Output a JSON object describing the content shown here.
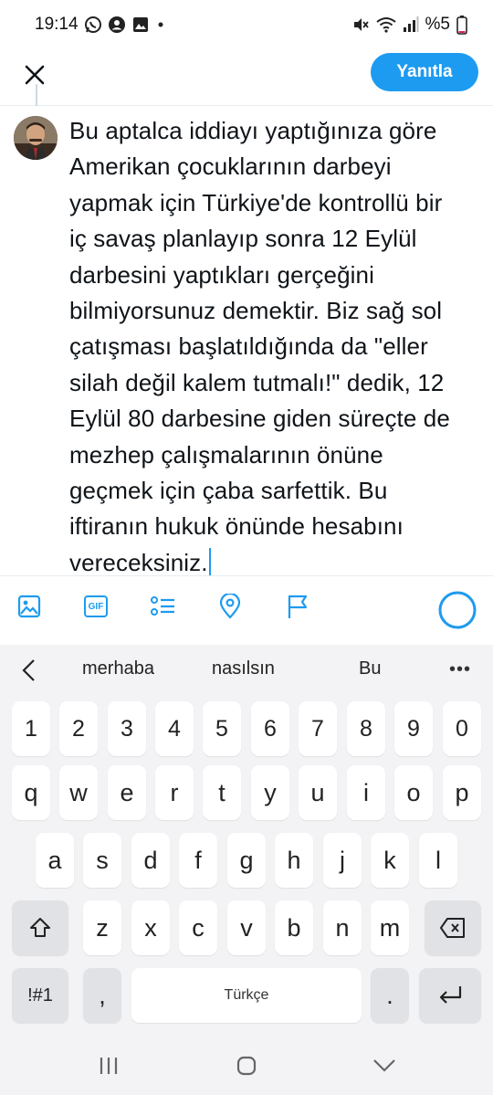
{
  "status": {
    "time": "19:14",
    "battery": "%5"
  },
  "header": {
    "reply_label": "Yanıtla"
  },
  "compose": {
    "lines": [
      "Bu aptalca iddiayı yaptığınıza göre",
      "Amerikan çocuklarının darbeyi",
      "yapmak için Türkiye'de kontrollü bir",
      "iç savaş planlayıp sonra 12 Eylül",
      "darbesini yaptıkları gerçeğini",
      "bilmiyorsunuz demektir. Biz sağ sol",
      "çatışması başlatıldığında da \"eller",
      "silah değil kalem tutmalı!\" dedik, 12",
      "Eylül 80 darbesine giden süreçte de",
      "mezhep çalışmalarının önüne",
      "geçmek için çaba sarfettik. Bu",
      "iftiranın hukuk önünde hesabını",
      "vereceksiniz."
    ]
  },
  "toolbar": {
    "gif_label": "GIF"
  },
  "keyboard": {
    "suggestions": [
      "merhaba",
      "nasılsın",
      "Bu"
    ],
    "more": "•••",
    "row_numbers": [
      "1",
      "2",
      "3",
      "4",
      "5",
      "6",
      "7",
      "8",
      "9",
      "0"
    ],
    "row1": [
      "q",
      "w",
      "e",
      "r",
      "t",
      "y",
      "u",
      "i",
      "o",
      "p"
    ],
    "row2": [
      "a",
      "s",
      "d",
      "f",
      "g",
      "h",
      "j",
      "k",
      "l"
    ],
    "row3": [
      "z",
      "x",
      "c",
      "v",
      "b",
      "n",
      "m"
    ],
    "symbols_label": "!#1",
    "comma": ",",
    "space_label": "Türkçe",
    "period": "."
  },
  "colors": {
    "accent": "#1d9bf0",
    "text": "#0f1419",
    "keyboard_bg": "#f3f3f5"
  }
}
